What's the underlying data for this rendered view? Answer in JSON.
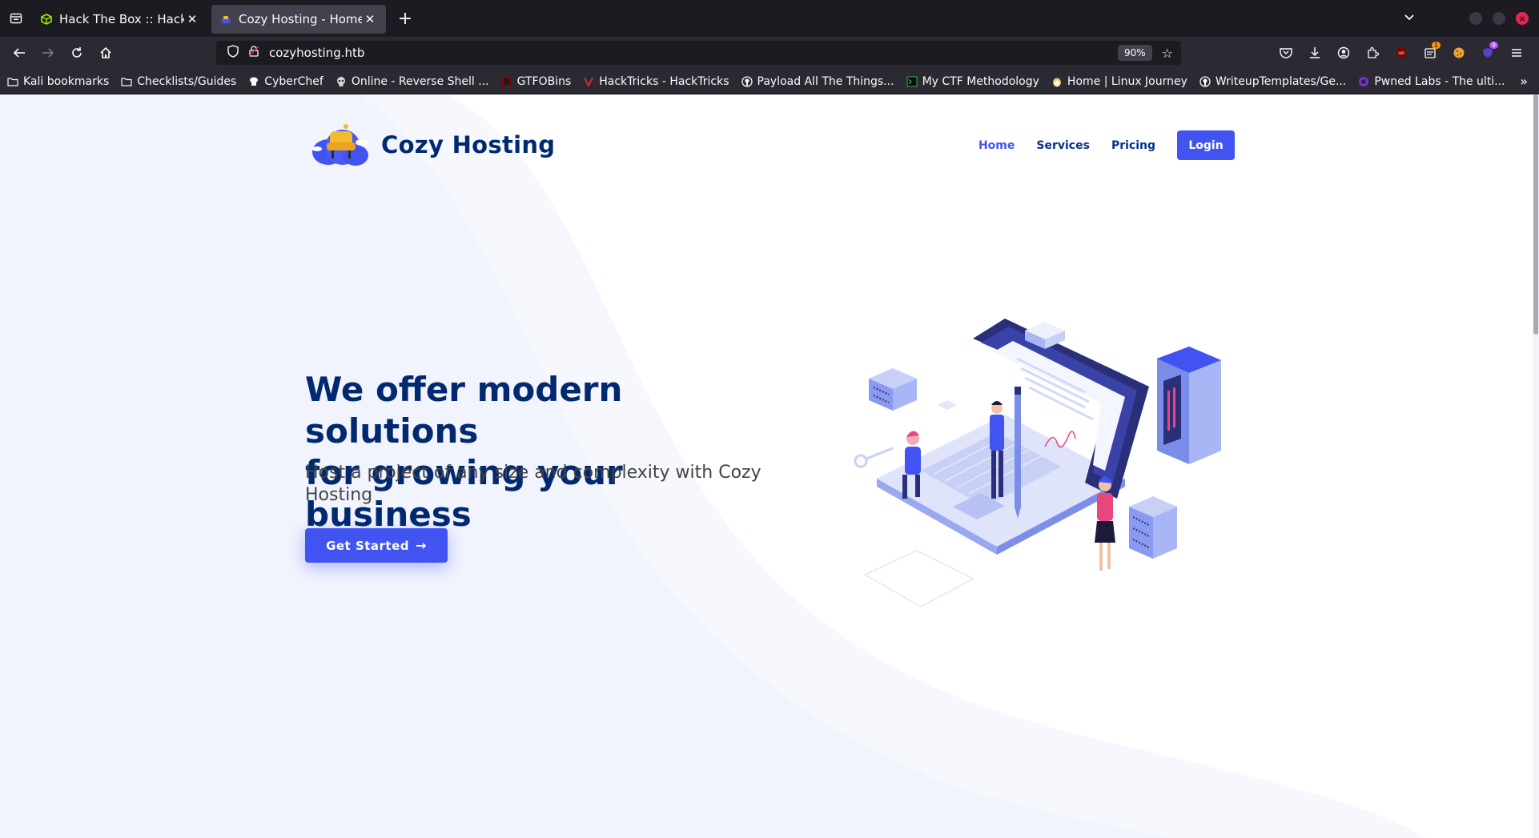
{
  "browser": {
    "tabs": [
      {
        "title": "Hack The Box :: Hack The",
        "active": false
      },
      {
        "title": "Cozy Hosting - Home",
        "active": true
      }
    ],
    "new_tab_symbol": "+",
    "close_symbol": "✕",
    "url": "cozyhosting.htb",
    "zoom": "90%",
    "bookmarks": [
      {
        "label": "Kali bookmarks",
        "icon": "folder-icon"
      },
      {
        "label": "Checklists/Guides",
        "icon": "folder-icon"
      },
      {
        "label": "CyberChef",
        "icon": "cyberchef-icon"
      },
      {
        "label": "Online - Reverse Shell ...",
        "icon": "skull-icon"
      },
      {
        "label": "GTFOBins",
        "icon": "gtfobins-icon"
      },
      {
        "label": "HackTricks - HackTricks",
        "icon": "hacktricks-icon"
      },
      {
        "label": "Payload All The Things...",
        "icon": "github-icon"
      },
      {
        "label": "My CTF Methodology",
        "icon": "terminal-icon"
      },
      {
        "label": "Home | Linux Journey",
        "icon": "linux-journey-icon"
      },
      {
        "label": "WriteupTemplates/Ge...",
        "icon": "github-icon"
      },
      {
        "label": "Pwned Labs - The ulti...",
        "icon": "pwnedlabs-icon"
      }
    ],
    "toolbar_badges": {
      "ublock": "",
      "notes": "1",
      "extension": "9"
    }
  },
  "site": {
    "brand": "Cozy Hosting",
    "nav": [
      {
        "label": "Home",
        "active": true
      },
      {
        "label": "Services",
        "active": false
      },
      {
        "label": "Pricing",
        "active": false
      }
    ],
    "login_label": "Login",
    "hero_title_line1": "We offer modern solutions",
    "hero_title_line2": "for growing your business",
    "hero_subtitle": "Host a project of any size and complexity with Cozy Hosting",
    "cta_label": "Get Started",
    "cta_arrow": "→"
  },
  "colors": {
    "primary": "#4154f1",
    "heading": "#012970",
    "nav_text": "#013289",
    "chrome_dark": "#1c1b22",
    "chrome_toolbar": "#2b2a33"
  }
}
